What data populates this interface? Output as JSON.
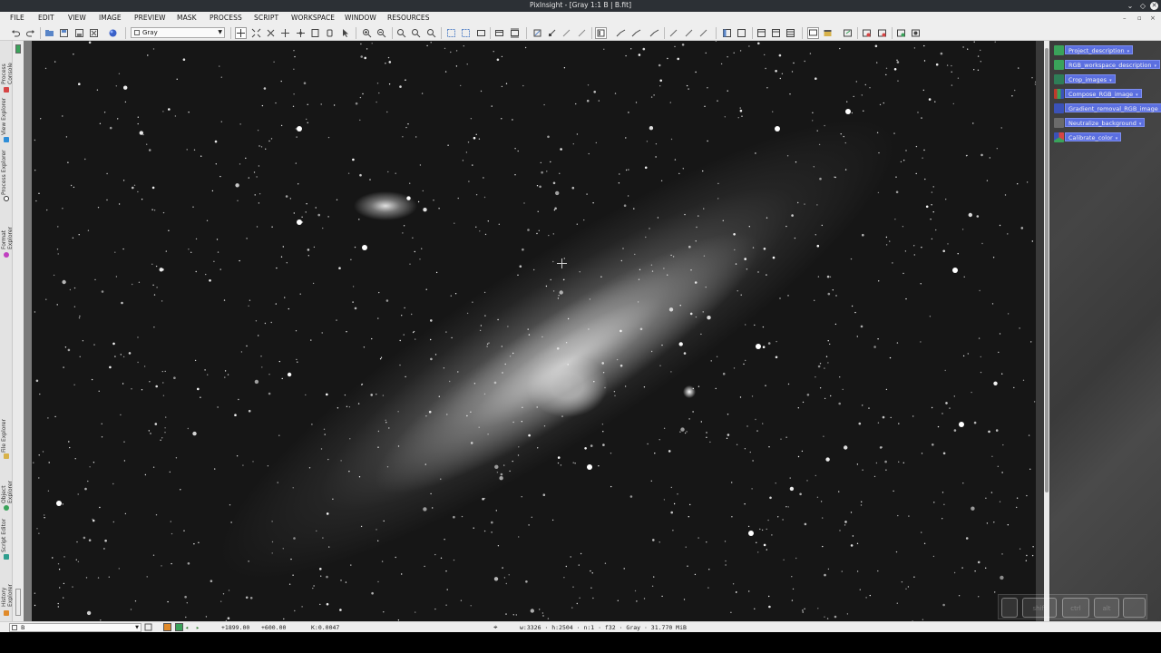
{
  "window": {
    "title": "PixInsight - [Gray 1:1 B | B.fit]",
    "controls": {
      "minimize": "⌄",
      "restore": "◇",
      "close": "✕"
    }
  },
  "menu": {
    "items": [
      "FILE",
      "EDIT",
      "VIEW",
      "IMAGE",
      "PREVIEW",
      "MASK",
      "PROCESS",
      "SCRIPT",
      "WORKSPACE",
      "WINDOW",
      "RESOURCES"
    ],
    "mdi_controls": {
      "minimize": "–",
      "restore": "▫",
      "close": "×"
    }
  },
  "toolbar": {
    "view_select_value": "Gray"
  },
  "left_dock": {
    "tabs_top": [
      "Process Console",
      "View Explorer",
      "Process Explorer",
      "Format Explorer"
    ],
    "tabs_bottom": [
      "File Explorer",
      "Object Explorer",
      "Script Editor",
      "History Explorer"
    ]
  },
  "workspace_icons": [
    {
      "label": "Project_description",
      "color": "#3aa35a"
    },
    {
      "label": "RGB_workspace_description",
      "color": "#3aa35a"
    },
    {
      "label": "Crop_images",
      "color": "#2f7e57"
    },
    {
      "label": "Compose_RGB_image",
      "color": "#c0392b"
    },
    {
      "label": "Gradient_removal_RGB_image",
      "color": "#3b52b8"
    },
    {
      "label": "Neutralize_background",
      "color": "#6b6b6b"
    },
    {
      "label": "Calibrate_color",
      "color": "#d64545"
    }
  ],
  "keys_overlay": [
    "",
    "shift",
    "ctrl",
    "alt",
    ""
  ],
  "status": {
    "view_name": "B",
    "x_coord": "+1899.00",
    "y_coord": "+600.00",
    "k_value": "K:0.0047",
    "image_info": "w:3326 · h:2504 · n:1 · f32 · Gray · 31.770 MiB"
  }
}
